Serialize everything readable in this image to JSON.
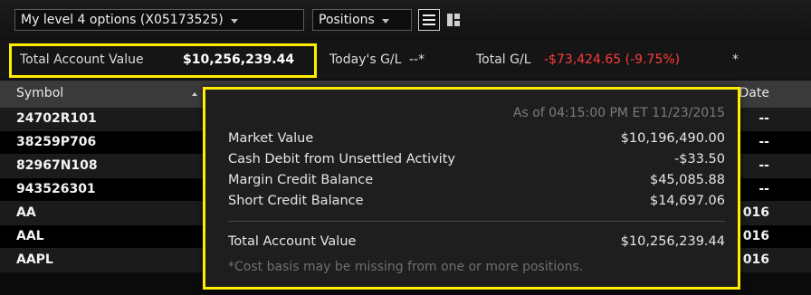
{
  "toolbar": {
    "account_select": "My level 4 options (X05173525)",
    "view_select": "Positions",
    "list_view_icon": "list-view-icon",
    "tile_view_icon": "tile-view-icon"
  },
  "summary": {
    "total_label": "Total Account Value",
    "total_value": "$10,256,239.44",
    "today_label": "Today's G/L",
    "today_value": "--*",
    "total_gl_label": "Total G/L",
    "total_gl_value": "-$73,424.65 (-9.75%)",
    "total_gl_suffix": "*"
  },
  "table": {
    "headers": {
      "symbol": "Symbol",
      "date": "Date"
    },
    "rows": [
      {
        "symbol": "24702R101",
        "date": "--"
      },
      {
        "symbol": "38259P706",
        "date": "--"
      },
      {
        "symbol": "82967N108",
        "date": "--"
      },
      {
        "symbol": "943526301",
        "date": "--"
      },
      {
        "symbol": "AA",
        "date": "016"
      },
      {
        "symbol": "AAL",
        "date": "016"
      },
      {
        "symbol": "AAPL",
        "date": "016"
      }
    ]
  },
  "popup": {
    "as_of": "As of 04:15:00 PM ET 11/23/2015",
    "market_value_label": "Market Value",
    "market_value": "$10,196,490.00",
    "cash_debit_label": "Cash Debit from Unsettled Activity",
    "cash_debit": "-$33.50",
    "margin_credit_label": "Margin Credit Balance",
    "margin_credit": "$45,085.88",
    "short_credit_label": "Short Credit Balance",
    "short_credit": "$14,697.06",
    "total_label": "Total Account Value",
    "total_value": "$10,256,239.44",
    "note": "*Cost basis may be missing from one or more positions."
  },
  "colors": {
    "highlight": "#ffee00",
    "negative": "#ff3b3b",
    "background": "#0b0b0b"
  }
}
